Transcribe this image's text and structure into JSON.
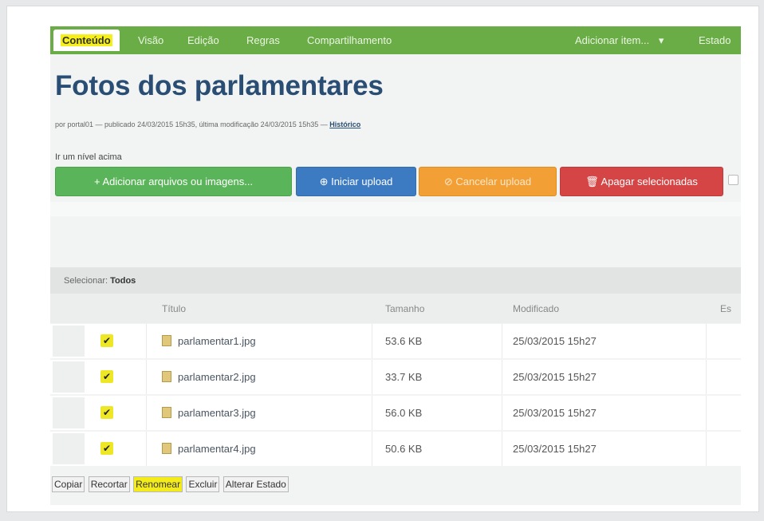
{
  "toolbar": {
    "tabs": [
      "Conteúdo",
      "Visão",
      "Edição",
      "Regras",
      "Compartilhamento"
    ],
    "add_item": "Adicionar item...",
    "state": "Estado"
  },
  "page": {
    "title": "Fotos dos parlamentares",
    "byline": "por portal01 — publicado 24/03/2015 15h35, última modificação 24/03/2015 15h35 —",
    "history": "Histórico",
    "up_level": "Ir um nível acima"
  },
  "upload": {
    "add": "+ Adicionar arquivos ou imagens...",
    "start": "⊕ Iniciar upload",
    "cancel": "⊘ Cancelar upload",
    "delete": "🗑 Apagar selecionadas"
  },
  "listing": {
    "select_label": "Selecionar:",
    "select_all": "Todos",
    "columns": [
      "Título",
      "Tamanho",
      "Modificado",
      "Es"
    ],
    "rows": [
      {
        "title": "parlamentar1.jpg",
        "size": "53.6 KB",
        "modified": "25/03/2015 15h27"
      },
      {
        "title": "parlamentar2.jpg",
        "size": "33.7 KB",
        "modified": "25/03/2015 15h27"
      },
      {
        "title": "parlamentar3.jpg",
        "size": "56.0 KB",
        "modified": "25/03/2015 15h27"
      },
      {
        "title": "parlamentar4.jpg",
        "size": "50.6 KB",
        "modified": "25/03/2015 15h27"
      }
    ]
  },
  "actions": [
    "Copiar",
    "Recortar",
    "Renomear",
    "Excluir",
    "Alterar Estado"
  ]
}
